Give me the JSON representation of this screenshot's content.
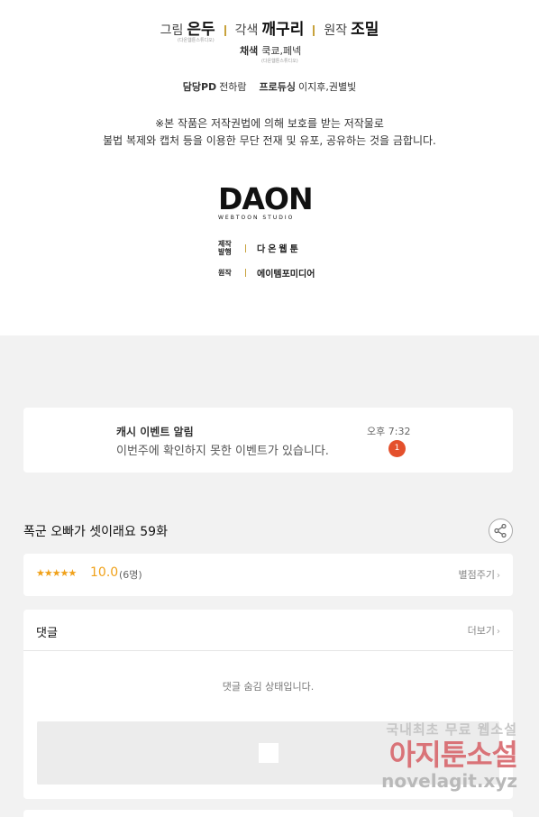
{
  "credits": {
    "art_label": "그림",
    "art_name": "은두",
    "art_sub": "(다온웹툰스튜디오)",
    "adapt_label": "각색",
    "adapt_name": "깨구리",
    "orig_label": "원작",
    "orig_name": "조밀",
    "color_label": "채색",
    "color_name": "쿡쿄,페넥",
    "color_sub": "(다온웹툰스튜디오)",
    "pd_label": "담당PD",
    "pd_name": "전하람",
    "producing_label": "프로듀싱",
    "producing_name": "이지후,권별빛",
    "notice_line1": "※본 작품은 저작권법에 의해 보호를 받는 저작물로",
    "notice_line2": "불법 복제와 캡처 등을 이용한 무단 전재 및 유포, 공유하는 것을 금합니다.",
    "logo_main": "DAON",
    "logo_sub": "WEBTOON STUDIO",
    "prod_label_1": "제작",
    "prod_label_2": "발행",
    "prod_value": "다온웹툰",
    "original_label": "원작",
    "original_value": "에이템포미디어"
  },
  "notification": {
    "title": "캐시 이벤트 알림",
    "message": "이번주에 확인하지 못한 이벤트가 있습니다.",
    "time": "오후 7:32",
    "badge": "1"
  },
  "episode": {
    "title": "폭군 오빠가 셋이래요 59화",
    "share_icon": "share-icon"
  },
  "rating": {
    "stars": "★★★★★",
    "score": "10.0",
    "count": "(6명)",
    "rate_link": "별점주기"
  },
  "comments": {
    "header": "댓글",
    "more": "더보기",
    "hidden_message": "댓글 숨김 상태입니다."
  },
  "watermark": {
    "line1": "국내최초 무료 웹소설",
    "line2": "아지툰소설",
    "line3": "novelagit.xyz"
  },
  "colors": {
    "accent_gold": "#c8a23c",
    "badge_red": "#e4502c",
    "star_orange": "#f0a11a",
    "page_gray": "#f2f2f2"
  }
}
